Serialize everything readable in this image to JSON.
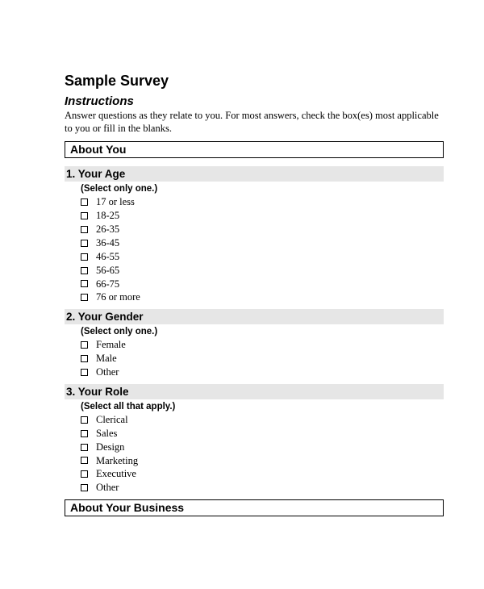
{
  "title": "Sample Survey",
  "instructions": {
    "heading": "Instructions",
    "body": "Answer questions as they relate to you. For most answers, check the box(es) most applicable to you or fill in the blanks."
  },
  "sections": {
    "about_you": "About You",
    "about_business": "About Your Business"
  },
  "questions": [
    {
      "title": "1. Your Age",
      "hint": "(Select only one.)",
      "options": [
        "17 or less",
        "18-25",
        "26-35",
        "36-45",
        "46-55",
        "56-65",
        "66-75",
        "76 or more"
      ]
    },
    {
      "title": "2. Your Gender",
      "hint": "(Select only one.)",
      "options": [
        "Female",
        "Male",
        "Other"
      ]
    },
    {
      "title": "3. Your Role",
      "hint": "(Select all that apply.)",
      "options": [
        "Clerical",
        "Sales",
        "Design",
        "Marketing",
        "Executive",
        "Other"
      ]
    }
  ]
}
